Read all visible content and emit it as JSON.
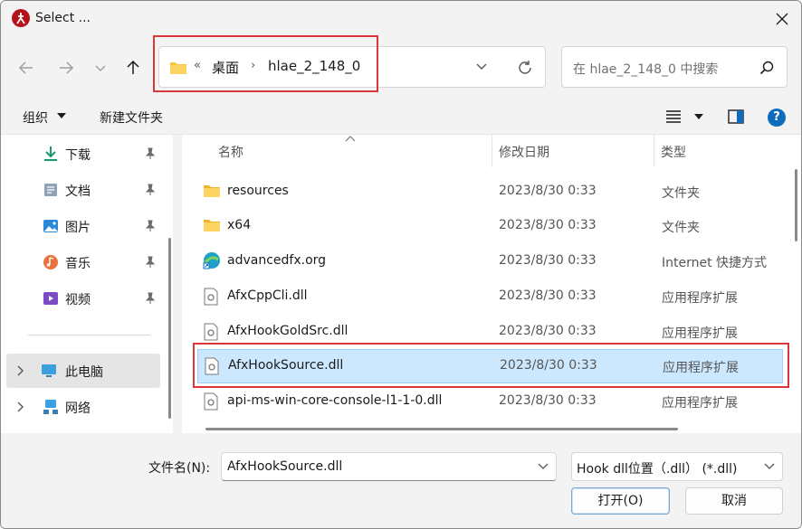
{
  "window": {
    "title": "Select ..."
  },
  "address": {
    "overflow": "«",
    "seg1": "桌面",
    "sep": "›",
    "seg2": "hlae_2_148_0"
  },
  "search": {
    "placeholder": "在 hlae_2_148_0 中搜索"
  },
  "toolbar": {
    "organize_label": "组织",
    "new_folder_label": "新建文件夹",
    "help_label": "?"
  },
  "sidebar": {
    "items": [
      {
        "label": "下载",
        "icon": "download-icon"
      },
      {
        "label": "文档",
        "icon": "document-icon"
      },
      {
        "label": "图片",
        "icon": "picture-icon"
      },
      {
        "label": "音乐",
        "icon": "music-icon"
      },
      {
        "label": "视频",
        "icon": "video-icon"
      },
      {
        "label": "此电脑",
        "icon": "pc-icon"
      },
      {
        "label": "网络",
        "icon": "network-icon"
      }
    ]
  },
  "columns": {
    "name": "名称",
    "date": "修改日期",
    "type": "类型"
  },
  "files": [
    {
      "name": "resources",
      "date": "2023/8/30 0:33",
      "type": "文件夹",
      "icon": "folder-icon"
    },
    {
      "name": "x64",
      "date": "2023/8/30 0:33",
      "type": "文件夹",
      "icon": "folder-icon"
    },
    {
      "name": "advancedfx.org",
      "date": "2023/8/30 0:33",
      "type": "Internet 快捷方式",
      "icon": "internet-shortcut-icon"
    },
    {
      "name": "AfxCppCli.dll",
      "date": "2023/8/30 0:33",
      "type": "应用程序扩展",
      "icon": "dll-icon"
    },
    {
      "name": "AfxHookGoldSrc.dll",
      "date": "2023/8/30 0:33",
      "type": "应用程序扩展",
      "icon": "dll-icon"
    },
    {
      "name": "AfxHookSource.dll",
      "date": "2023/8/30 0:33",
      "type": "应用程序扩展",
      "icon": "dll-icon",
      "selected": true
    },
    {
      "name": "api-ms-win-core-console-l1-1-0.dll",
      "date": "2023/8/30 0:33",
      "type": "应用程序扩展",
      "icon": "dll-icon"
    }
  ],
  "bottom": {
    "filename_label": "文件名(N):",
    "filename_value": "AfxHookSource.dll",
    "filter_value": "Hook dll位置（.dll）  (*.dll)",
    "open_label": "打开(O)",
    "cancel_label": "取消"
  },
  "colors": {
    "accent": "#0f6cbd",
    "selection": "#cce8ff",
    "annotation": "#d9383a",
    "folder": "#f8c440"
  }
}
